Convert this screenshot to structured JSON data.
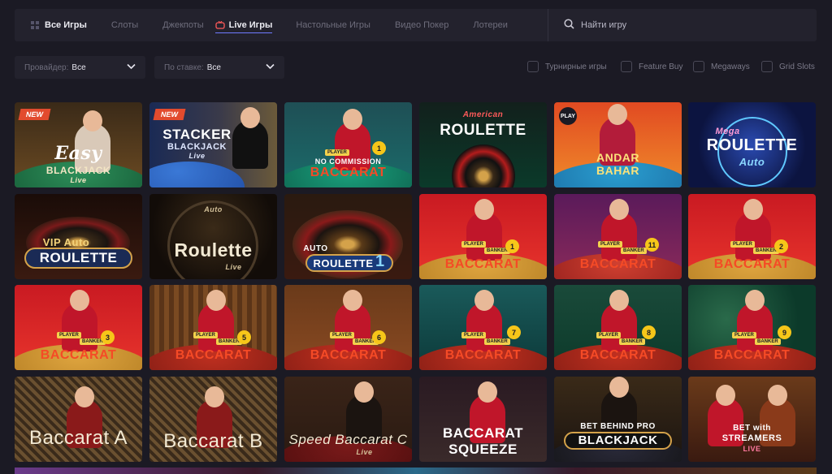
{
  "nav": {
    "tabs": [
      {
        "label": "Все Игры"
      },
      {
        "label": "Слоты"
      },
      {
        "label": "Джекпоты"
      },
      {
        "label": "Live Игры"
      },
      {
        "label": "Настольные Игры"
      },
      {
        "label": "Видео Покер"
      },
      {
        "label": "Лотереи"
      }
    ],
    "search_label": "Найти игру"
  },
  "filters": {
    "provider": {
      "label": "Провайдер:",
      "value": "Все"
    },
    "stake": {
      "label": "По ставке:",
      "value": "Все"
    },
    "checks": [
      {
        "label": "Турнирные игры"
      },
      {
        "label": "Feature Buy"
      },
      {
        "label": "Megaways"
      },
      {
        "label": "Grid Slots"
      }
    ]
  },
  "tiles": [
    {
      "badge": "NEW",
      "line1": "Easy",
      "line2": "BLACKJACK",
      "sub": "Live"
    },
    {
      "badge": "NEW",
      "line1": "STACKER",
      "line2": "BLACKJACK",
      "sub": "Live"
    },
    {
      "line1": "NO COMMISSION",
      "line2": "BACCARAT",
      "num": "1",
      "tag": "PLAYER"
    },
    {
      "line1": "American",
      "line2": "ROULETTE"
    },
    {
      "line1": "PLAY",
      "line2": "ANDAR",
      "line3": "BAHAR"
    },
    {
      "line1": "Mega",
      "line2": "ROULETTE",
      "sub": "Auto"
    },
    {
      "line1": "VIP Auto",
      "line2": "ROULETTE"
    },
    {
      "line1": "Auto",
      "line2": "Roulette",
      "sub": "Live"
    },
    {
      "line1": "AUTO",
      "line2": "ROULETTE",
      "num": "1"
    },
    {
      "line2": "BACCARAT",
      "num": "1",
      "tag": "PLAYER",
      "tag2": "BANKER"
    },
    {
      "line2": "BACCARAT",
      "num": "11",
      "tag": "PLAYER",
      "tag2": "BANKER"
    },
    {
      "line2": "BACCARAT",
      "num": "2",
      "tag": "PLAYER",
      "tag2": "BANKER"
    },
    {
      "line2": "BACCARAT",
      "num": "3",
      "tag": "PLAYER",
      "tag2": "BANKER"
    },
    {
      "line2": "BACCARAT",
      "num": "5",
      "tag": "PLAYER",
      "tag2": "BANKER"
    },
    {
      "line2": "BACCARAT",
      "num": "6",
      "tag": "PLAYER",
      "tag2": "BANKER"
    },
    {
      "line2": "BACCARAT",
      "num": "7",
      "tag": "PLAYER",
      "tag2": "BANKER"
    },
    {
      "line2": "BACCARAT",
      "num": "8",
      "tag": "PLAYER",
      "tag2": "BANKER"
    },
    {
      "line2": "BACCARAT",
      "num": "9",
      "tag": "PLAYER",
      "tag2": "BANKER"
    },
    {
      "line2": "Baccarat A"
    },
    {
      "line2": "Baccarat B"
    },
    {
      "line2": "Speed Baccarat C",
      "sub": "Live"
    },
    {
      "line2": "BACCARAT",
      "line3": "SQUEEZE"
    },
    {
      "line1": "BET BEHIND PRO",
      "line2": "BLACKJACK"
    },
    {
      "line1": "BET with",
      "line2": "STREAMERS",
      "sub": "LIVE"
    }
  ],
  "colors": {
    "accent": "#6f7bff",
    "badge_new": "#e24b2e",
    "gold": "#f6c619"
  }
}
